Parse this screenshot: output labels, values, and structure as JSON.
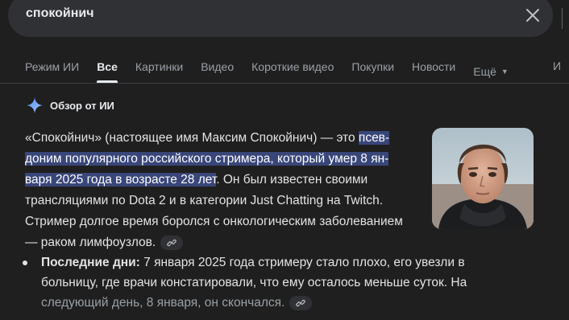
{
  "search": {
    "query": "спокойнич"
  },
  "tabs": [
    {
      "label": "Режим ИИ",
      "active": false
    },
    {
      "label": "Все",
      "active": true
    },
    {
      "label": "Картинки",
      "active": false
    },
    {
      "label": "Видео",
      "active": false
    },
    {
      "label": "Короткие видео",
      "active": false
    },
    {
      "label": "Покупки",
      "active": false
    },
    {
      "label": "Новости",
      "active": false
    },
    {
      "label": "Ещё",
      "active": false
    }
  ],
  "tab_overflow": "И",
  "ai_overview": {
    "title": "Обзор от ИИ",
    "intro": "«Спокойнич» (настоящее имя Максим Спокойнич) — это ",
    "line1_hl": "псев-",
    "line2_hl": "доним популярного российского стримера, который умер 8 ян-",
    "line3_hl": "варя 2025 года в возрасте 28 лет",
    "line3_rest": ". Он был известен своими",
    "line4": "трансляциями по Dota 2 и в категории Just Chatting на Twitch.",
    "line5": "Стример долгое время боролся с онкологическим заболеванием",
    "line6": "— раком лимфоузлов."
  },
  "bullet": {
    "label": "Последние дни:",
    "text_line1": " 7 января 2025 года стримеру стало плохо, его увезли в",
    "text_line2": "больницу, где врачи констатировали, что ему осталось меньше суток. На",
    "text_line3": "следующий день, 8 января, он скончался."
  },
  "colors": {
    "background": "#1f1f1f",
    "highlight": "#394679",
    "search_bg": "#303134",
    "accent": "#8ab4f8"
  },
  "icons": {
    "clear": "close-icon",
    "ai": "sparkle-icon",
    "link": "link-icon"
  }
}
